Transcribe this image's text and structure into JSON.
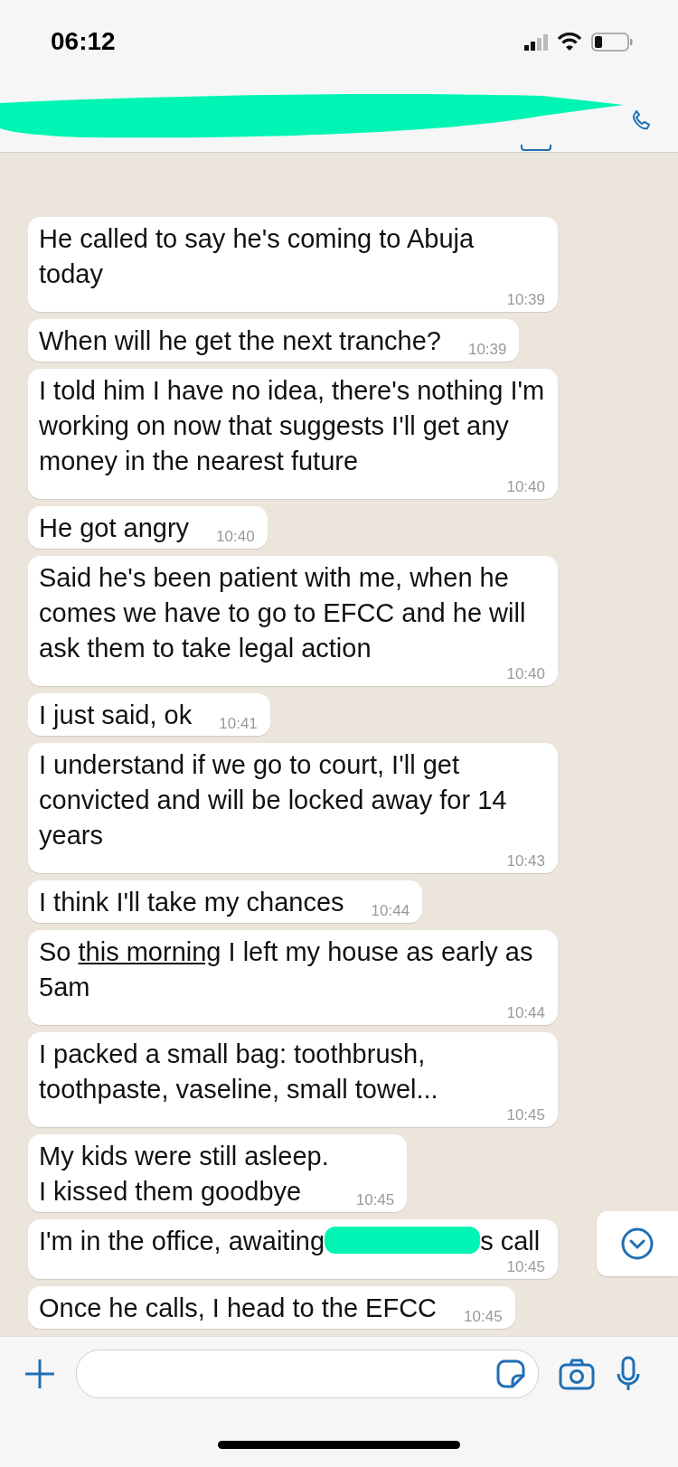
{
  "status_bar": {
    "time": "06:12"
  },
  "header": {
    "redacted": true
  },
  "messages": [
    {
      "parts": [
        {
          "kind": "text",
          "text": "He called to say he's coming to Abuja today"
        }
      ],
      "time": "10:39"
    },
    {
      "parts": [
        {
          "kind": "text",
          "text": "When will he get the next tranche?"
        }
      ],
      "time": "10:39"
    },
    {
      "parts": [
        {
          "kind": "text",
          "text": "I told him I have no idea, there's nothing I'm working on now that suggests I'll get any money in the nearest future"
        }
      ],
      "time": "10:40"
    },
    {
      "parts": [
        {
          "kind": "text",
          "text": "He got angry"
        }
      ],
      "time": "10:40"
    },
    {
      "parts": [
        {
          "kind": "text",
          "text": "Said he's been patient with me, when he comes we have to go to EFCC and he will ask them to take legal action"
        }
      ],
      "time": "10:40"
    },
    {
      "parts": [
        {
          "kind": "text",
          "text": "I just said, ok"
        }
      ],
      "time": "10:41"
    },
    {
      "parts": [
        {
          "kind": "text",
          "text": "I understand if we go to court, I'll get convicted and will be locked away for 14 years"
        }
      ],
      "time": "10:43"
    },
    {
      "parts": [
        {
          "kind": "text",
          "text": "I think I'll take my chances"
        }
      ],
      "time": "10:44"
    },
    {
      "parts": [
        {
          "kind": "text",
          "text": "So "
        },
        {
          "kind": "link",
          "text": "this morning"
        },
        {
          "kind": "text",
          "text": " I left my house as early as 5am"
        }
      ],
      "time": "10:44"
    },
    {
      "parts": [
        {
          "kind": "text",
          "text": "I packed a small bag: toothbrush, toothpaste, vaseline, small towel..."
        }
      ],
      "time": "10:45"
    },
    {
      "parts": [
        {
          "kind": "text",
          "text": "My kids were still asleep."
        },
        {
          "kind": "break"
        },
        {
          "kind": "text",
          "text": "I kissed them goodbye"
        }
      ],
      "time": "10:45"
    },
    {
      "parts": [
        {
          "kind": "text",
          "text": "I'm in the office, awaiting"
        },
        {
          "kind": "redaction"
        },
        {
          "kind": "text",
          "text": "s call"
        }
      ],
      "time": "10:45"
    },
    {
      "parts": [
        {
          "kind": "text",
          "text": "Once he calls, I head to the EFCC"
        }
      ],
      "time": "10:45"
    }
  ],
  "composer": {
    "scroll_down_button": true
  }
}
